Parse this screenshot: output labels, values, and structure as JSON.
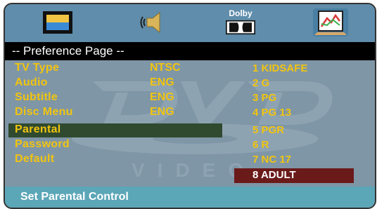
{
  "toolbar": {
    "icons": [
      {
        "name": "general-setup-icon"
      },
      {
        "name": "audio-setup-icon"
      },
      {
        "name": "dolby-digital-icon",
        "label": "Dolby"
      },
      {
        "name": "preference-setup-icon",
        "active": true
      }
    ]
  },
  "title": "-- Preference Page --",
  "menu": {
    "items": [
      {
        "label": "TV Type",
        "value": "NTSC"
      },
      {
        "label": "Audio",
        "value": "ENG"
      },
      {
        "label": "Subtitle",
        "value": "ENG"
      },
      {
        "label": "Disc Menu",
        "value": "ENG"
      },
      {
        "label": "Parental",
        "value": "",
        "selected": true
      },
      {
        "label": "Password",
        "value": ""
      },
      {
        "label": "Default",
        "value": ""
      }
    ]
  },
  "ratings": {
    "options": [
      "1 KIDSAFE",
      "2 G",
      "3 PG",
      "4 PG 13",
      "5 PGR",
      "6 R",
      "7 NC 17",
      "8 ADULT"
    ],
    "selected_index": 7
  },
  "watermark": {
    "logo": "DVD",
    "text": "VIDEO"
  },
  "status": "Set Parental Control",
  "colors": {
    "text_yellow": "#f1c40f",
    "top_bar": "#5f8dab",
    "title_bar": "#000000",
    "content_bg": "#7f96a6",
    "status_bar": "#5ba6b7",
    "parental_highlight": "#2f4a2f",
    "rating_highlight": "#6b1a1a"
  }
}
